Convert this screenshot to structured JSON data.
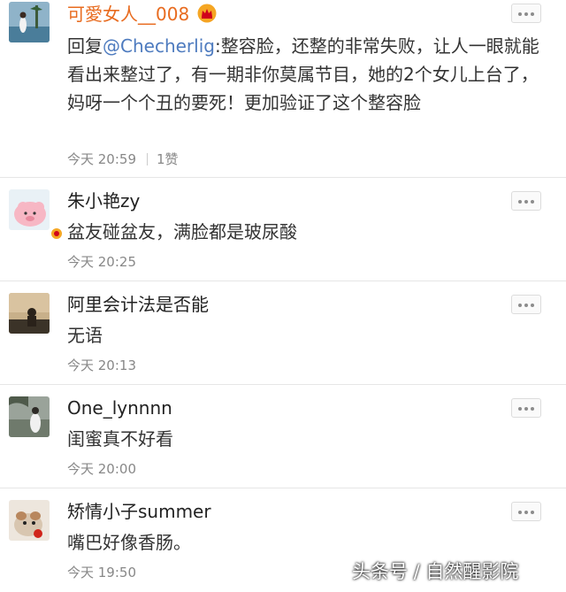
{
  "comments": [
    {
      "username": "可愛女人__008",
      "mention": "@Checherlig",
      "text_prefix": "回复",
      "text_suffix": ":整容脸，还整的非常失败，让人一眼就能看出来整过了，有一期非你莫属节目，她的2个女儿上台了，妈呀一个个丑的要死！更加验证了这个整容脸",
      "time": "今天 20:59",
      "likes": "1赞"
    },
    {
      "username": "朱小艳zy",
      "text": "盆友碰盆友，满脸都是玻尿酸",
      "time": "今天 20:25"
    },
    {
      "username": "阿里会计法是否能",
      "text": "无语",
      "time": "今天 20:13"
    },
    {
      "username": "One_lynnnn",
      "text": "闺蜜真不好看",
      "time": "今天 20:00"
    },
    {
      "username": "矫情小子summer",
      "text": "嘴巴好像香肠。",
      "time": "今天 19:50"
    }
  ],
  "watermark": "头条号 / 自然醒影院",
  "colors": {
    "vip_name": "#e86b1f",
    "mention": "#4e7bbf",
    "meta": "#888888"
  },
  "icons": {
    "more": "more-dots-icon",
    "vip": "crown-icon",
    "verified": "verified-badge-icon"
  }
}
